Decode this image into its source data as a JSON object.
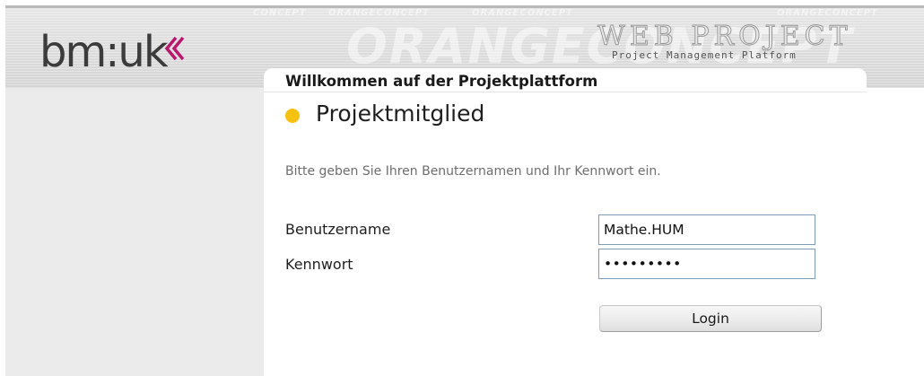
{
  "header": {
    "logo_text": "bm:uk",
    "watermark_word": "ORANGECONCEPT",
    "watermark_fragment": "CONCEPT",
    "product_title": "WEB PROJECT",
    "product_subtitle": "Project Management Platform"
  },
  "login": {
    "welcome_heading": "Willkommen auf der Projektplattform",
    "role_title": "Projektmitglied",
    "status_color": "#f5c211",
    "instruction": "Bitte geben Sie Ihren Benutzernamen und Ihr Kennwort ein.",
    "username_label": "Benutzername",
    "username_value": "Mathe.HUM",
    "password_label": "Kennwort",
    "password_value": "•••••••••",
    "login_button": "Login"
  },
  "colors": {
    "logo_accent": "#b8176e",
    "status_dot": "#f5c211",
    "input_border": "#7f9db9"
  }
}
